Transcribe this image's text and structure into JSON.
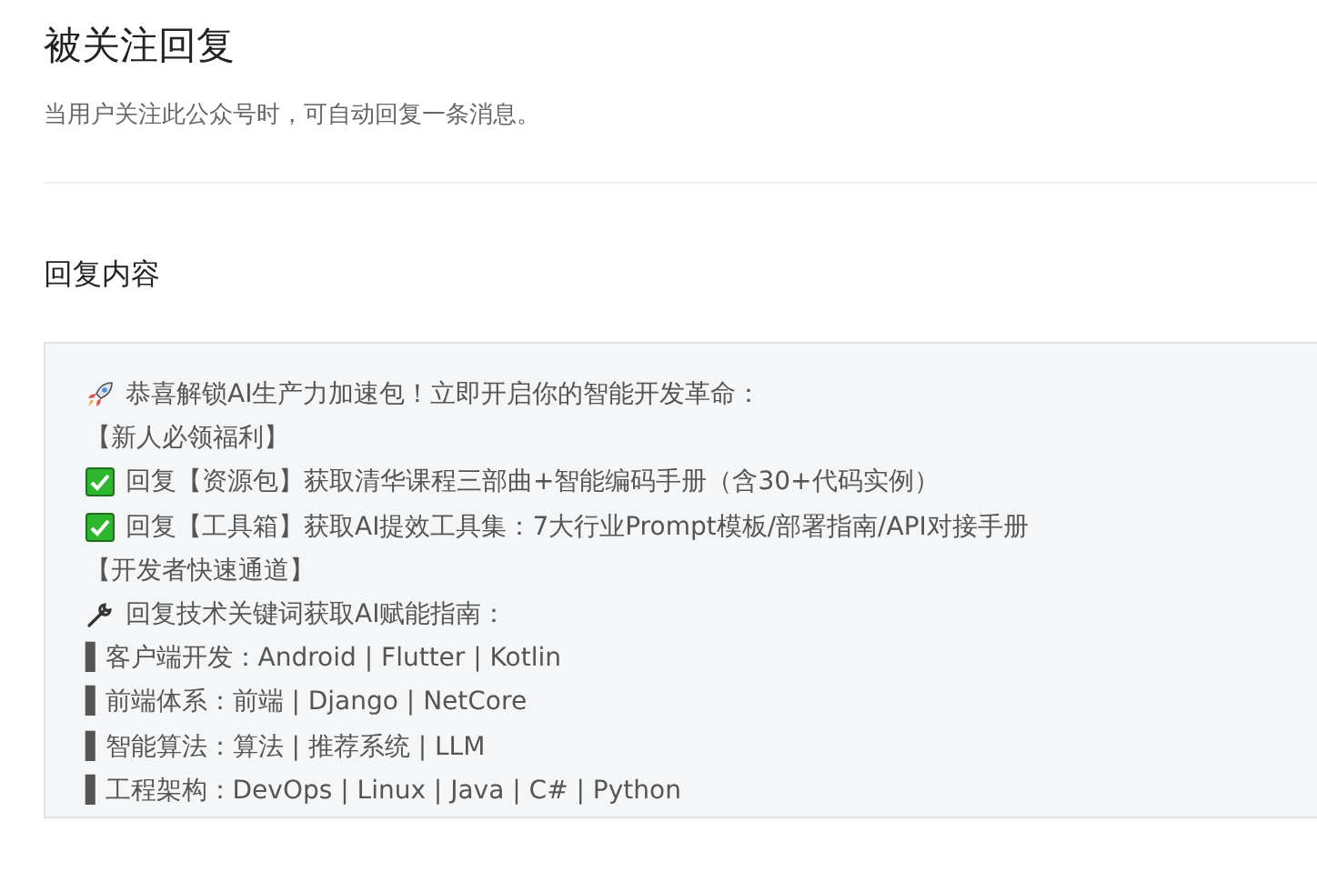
{
  "header": {
    "title": "被关注回复",
    "description": "当用户关注此公众号时，可自动回复一条消息。"
  },
  "reply": {
    "heading": "回复内容",
    "lines": [
      {
        "kind": "rocket",
        "text": "恭喜解锁AI生产力加速包！立即开启你的智能开发革命："
      },
      {
        "kind": "text",
        "text": "【新人必领福利】"
      },
      {
        "kind": "check",
        "text": "回复【资源包】获取清华课程三部曲+智能编码手册（含30+代码实例）"
      },
      {
        "kind": "check",
        "text": "回复【工具箱】获取AI提效工具集：7大行业Prompt模板/部署指南/API对接手册"
      },
      {
        "kind": "text",
        "text": "【开发者快速通道】"
      },
      {
        "kind": "wrench",
        "text": "回复技术关键词获取AI赋能指南："
      },
      {
        "kind": "text",
        "text": "▌客户端开发：Android | Flutter | Kotlin"
      },
      {
        "kind": "text",
        "text": "▌前端体系：前端 | Django | NetCore"
      },
      {
        "kind": "text",
        "text": "▌智能算法：算法 | 推荐系统 | LLM"
      },
      {
        "kind": "text",
        "text": "▌工程架构：DevOps | Linux | Java | C# | Python"
      }
    ]
  }
}
